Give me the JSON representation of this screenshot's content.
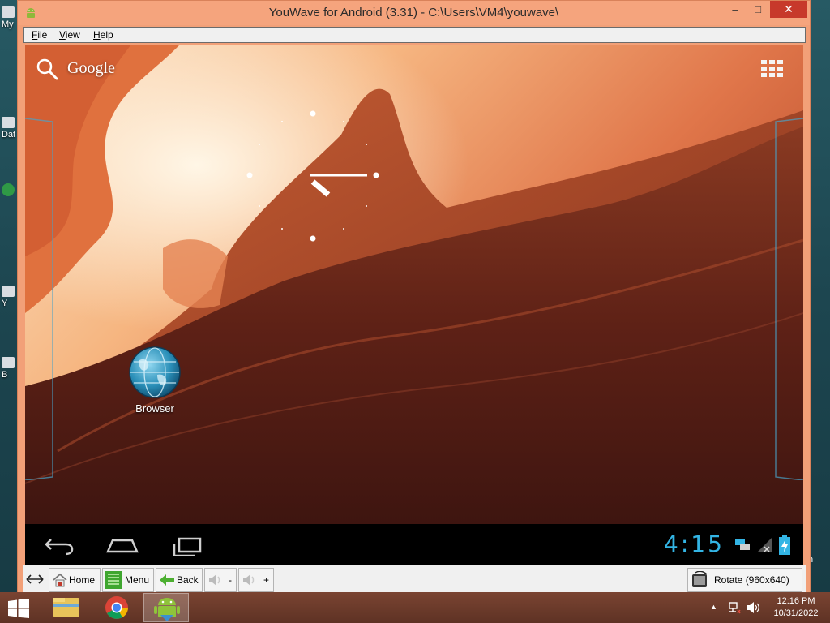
{
  "window": {
    "title": "YouWave for Android (3.31) - C:\\Users\\VM4\\youwave\\",
    "minimize_glyph": "–",
    "maximize_glyph": "□",
    "close_glyph": "✕"
  },
  "menu": {
    "items": [
      {
        "label": "File"
      },
      {
        "label": "View"
      },
      {
        "label": "Help"
      }
    ]
  },
  "android": {
    "search_label": "Google",
    "apps": [
      {
        "label": "Browser",
        "icon": "browser-globe-icon"
      }
    ],
    "status_time": "4:15",
    "accent_color": "#33b5e5"
  },
  "toolbar": {
    "home_label": "Home",
    "menu_label": "Menu",
    "back_label": "Back",
    "vol_down_label": "-",
    "vol_up_label": "+",
    "rotate_label": "Rotate (960x640)"
  },
  "desktop": {
    "icon_labels": [
      "My",
      "Dat",
      "",
      "Y",
      "B"
    ],
    "right_label": "n"
  },
  "taskbar": {
    "time": "12:16 PM",
    "date": "10/31/2022",
    "apps": [
      "file-explorer-icon",
      "chrome-icon",
      "youwave-android-icon"
    ]
  }
}
